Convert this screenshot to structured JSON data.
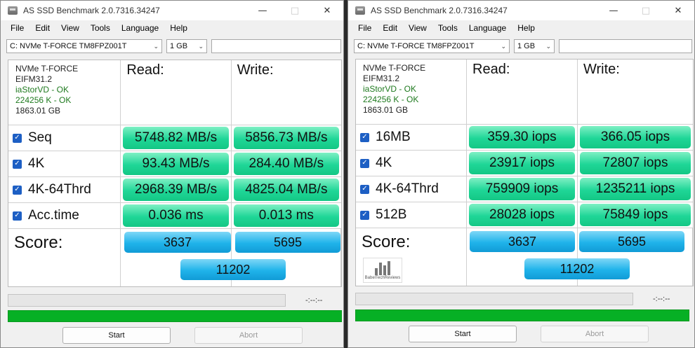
{
  "windows": [
    {
      "title": "AS SSD Benchmark 2.0.7316.34247",
      "menu": [
        "File",
        "Edit",
        "View",
        "Tools",
        "Language",
        "Help"
      ],
      "device_select": "C: NVMe T-FORCE TM8FPZ001T",
      "size_select": "1 GB",
      "drive_info": {
        "name": "NVMe T-FORCE",
        "firmware": "EIFM31.2",
        "driver": "iaStorVD - OK",
        "alignment": "224256 K - OK",
        "capacity": "1863.01 GB"
      },
      "read_header": "Read:",
      "write_header": "Write:",
      "tests": [
        {
          "label": "Seq",
          "checked": true,
          "read": "5748.82 MB/s",
          "write": "5856.73 MB/s"
        },
        {
          "label": "4K",
          "checked": true,
          "read": "93.43 MB/s",
          "write": "284.40 MB/s"
        },
        {
          "label": "4K-64Thrd",
          "checked": true,
          "read": "2968.39 MB/s",
          "write": "4825.04 MB/s"
        },
        {
          "label": "Acc.time",
          "checked": true,
          "read": "0.036 ms",
          "write": "0.013 ms"
        }
      ],
      "score_label": "Score:",
      "score_read": "3637",
      "score_write": "5695",
      "score_total": "11202",
      "time_display": "-:--:--",
      "progress": 1.0,
      "start_label": "Start",
      "abort_label": "Abort"
    },
    {
      "title": "AS SSD Benchmark 2.0.7316.34247",
      "menu": [
        "File",
        "Edit",
        "View",
        "Tools",
        "Language",
        "Help"
      ],
      "device_select": "C: NVMe T-FORCE TM8FPZ001T",
      "size_select": "1 GB",
      "drive_info": {
        "name": "NVMe T-FORCE",
        "firmware": "EIFM31.2",
        "driver": "iaStorVD - OK",
        "alignment": "224256 K - OK",
        "capacity": "1863.01 GB"
      },
      "read_header": "Read:",
      "write_header": "Write:",
      "tests": [
        {
          "label": "16MB",
          "checked": true,
          "read": "359.30 iops",
          "write": "366.05 iops"
        },
        {
          "label": "4K",
          "checked": true,
          "read": "23917 iops",
          "write": "72807 iops"
        },
        {
          "label": "4K-64Thrd",
          "checked": true,
          "read": "759909 iops",
          "write": "1235211 iops"
        },
        {
          "label": "512B",
          "checked": true,
          "read": "28028 iops",
          "write": "75849 iops"
        }
      ],
      "score_label": "Score:",
      "score_read": "3637",
      "score_write": "5695",
      "score_total": "11202",
      "logo_text": "BabelTechReviews",
      "time_display": "-:--:--",
      "progress": 1.0,
      "start_label": "Start",
      "abort_label": "Abort"
    }
  ],
  "colors": {
    "result_green": "#1fd697",
    "score_blue": "#1fb3ea",
    "progress_green": "#06b025",
    "checkbox_blue": "#1d5fc4"
  }
}
